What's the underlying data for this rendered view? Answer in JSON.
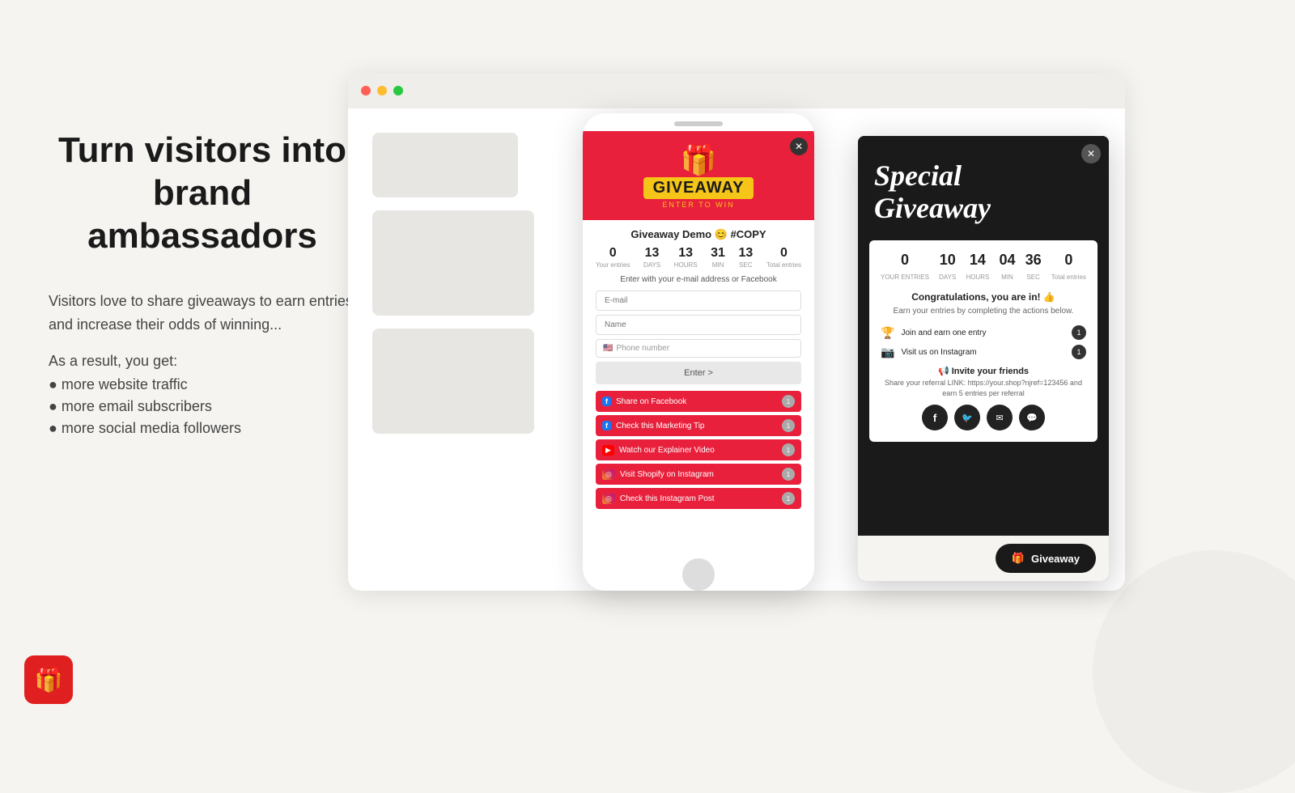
{
  "page": {
    "background": "#f5f4f0"
  },
  "left": {
    "heading": "Turn visitors into brand ambassadors",
    "sub_text": "Visitors love to share giveaways to earn entries and increase their odds of winning...",
    "result_intro": "As a result, you get:",
    "bullets": [
      "● more website traffic",
      "● more email subscribers",
      "● more social media followers"
    ]
  },
  "browser": {
    "dots": [
      "#ff5f57",
      "#febc2e",
      "#28c840"
    ]
  },
  "popup1": {
    "close": "✕",
    "gift_icon": "🎁",
    "giveaway_title": "GIVEAWAY",
    "enter_label": "ENTER TO WIN",
    "title": "Giveaway Demo 😊 #COPY",
    "timer": {
      "your_entries": {
        "value": "0",
        "label": "Your entries"
      },
      "days": {
        "value": "13",
        "label": "DAYS"
      },
      "hours": {
        "value": "13",
        "label": "HOURS"
      },
      "min": {
        "value": "31",
        "label": "MIN"
      },
      "sec": {
        "value": "13",
        "label": "SEC"
      },
      "total_entries": {
        "value": "0",
        "label": "Total entries"
      }
    },
    "description": "Enter with your e-mail address or Facebook",
    "email_placeholder": "E-mail",
    "name_placeholder": "Name",
    "phone_placeholder": "Phone number",
    "enter_btn": "Enter >",
    "actions": [
      {
        "icon": "f",
        "icon_type": "facebook",
        "label": "Share on Facebook",
        "badge": "1"
      },
      {
        "icon": "f",
        "icon_type": "facebook",
        "label": "Check this Marketing Tip",
        "badge": "1"
      },
      {
        "icon": "▶",
        "icon_type": "youtube",
        "label": "Watch our Explainer Video",
        "badge": "1"
      },
      {
        "icon": "◎",
        "icon_type": "instagram",
        "label": "Visit Shopify on Instagram",
        "badge": "1"
      },
      {
        "icon": "◎",
        "icon_type": "instagram",
        "label": "Check this Instagram Post",
        "badge": "1"
      }
    ]
  },
  "popup2": {
    "close": "✕",
    "title": "Special\nGiveaway",
    "timer": {
      "your_entries": {
        "value": "0",
        "label": "YOUR ENTRIES"
      },
      "days": {
        "value": "10",
        "label": "DAYS"
      },
      "hours": {
        "value": "14",
        "label": "HOURS"
      },
      "min": {
        "value": "04",
        "label": "MIN"
      },
      "sec": {
        "value": "36",
        "label": "SEC"
      },
      "total_entries": {
        "value": "0",
        "label": "Total entries"
      }
    },
    "congrats": "Congratulations, you are in! 👍",
    "earn_text": "Earn your entries\nby completing the actions below.",
    "actions": [
      {
        "icon": "🏆",
        "label": "Join and earn one entry",
        "badge": "1"
      },
      {
        "icon": "📷",
        "label": "Visit us on Instagram",
        "badge": "1"
      }
    ],
    "invite": {
      "title": "📢 Invite your friends",
      "sub": "Share your referral LINK:\nhttps://your.shop?njref=123456\nand earn 5 entries per referral"
    },
    "social_icons": [
      "f",
      "t",
      "✉",
      "💬"
    ],
    "giveaway_btn": "Giveaway",
    "gift_btn_icon": "🎁"
  },
  "logo": {
    "icon": "🎁"
  }
}
